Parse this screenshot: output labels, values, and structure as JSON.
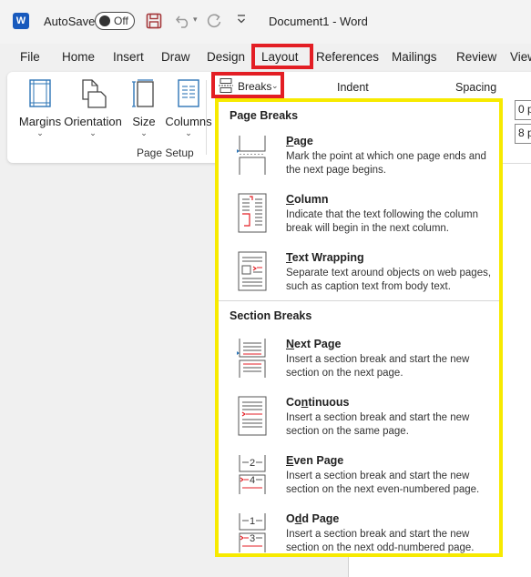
{
  "titlebar": {
    "app_logo": "W",
    "autosave_label": "AutoSave",
    "autosave_state": "Off",
    "document_title": "Document1  -  Word"
  },
  "tabs": [
    "File",
    "Home",
    "Insert",
    "Draw",
    "Design",
    "Layout",
    "References",
    "Mailings",
    "Review",
    "View"
  ],
  "active_tab": "Layout",
  "ribbon": {
    "buttons": [
      {
        "label": "Margins"
      },
      {
        "label": "Orientation"
      },
      {
        "label": "Size"
      },
      {
        "label": "Columns"
      }
    ],
    "group_label": "Page Setup",
    "breaks_label": "Breaks",
    "indent_label": "Indent",
    "spacing_label": "Spacing",
    "spacing_before": "0 p",
    "spacing_after": "8 p"
  },
  "breaks_menu": {
    "page_breaks_header": "Page Breaks",
    "section_breaks_header": "Section Breaks",
    "page_items": [
      {
        "title_pre": "",
        "title_u": "P",
        "title_post": "age",
        "desc": "Mark the point at which one page ends and the next page begins."
      },
      {
        "title_pre": "",
        "title_u": "C",
        "title_post": "olumn",
        "desc": "Indicate that the text following the column break will begin in the next column."
      },
      {
        "title_pre": "",
        "title_u": "T",
        "title_post": "ext Wrapping",
        "desc": "Separate text around objects on web pages, such as caption text from body text."
      }
    ],
    "section_items": [
      {
        "title_pre": "",
        "title_u": "N",
        "title_post": "ext Page",
        "desc": "Insert a section break and start the new section on the next page."
      },
      {
        "title_pre": "Co",
        "title_u": "n",
        "title_post": "tinuous",
        "desc": "Insert a section break and start the new section on the same page."
      },
      {
        "title_pre": "",
        "title_u": "E",
        "title_post": "ven Page",
        "desc": "Insert a section break and start the new section on the next even-numbered page."
      },
      {
        "title_pre": "O",
        "title_u": "d",
        "title_post": "d Page",
        "desc": "Insert a section break and start the new section on the next odd-numbered page."
      }
    ],
    "icon_numbers": {
      "even_top": "2",
      "even_bottom": "4",
      "odd_top": "1",
      "odd_bottom": "3"
    }
  },
  "colors": {
    "highlight_red": "#e31e24",
    "highlight_yellow": "#f7ea00",
    "word_blue": "#185abd"
  }
}
